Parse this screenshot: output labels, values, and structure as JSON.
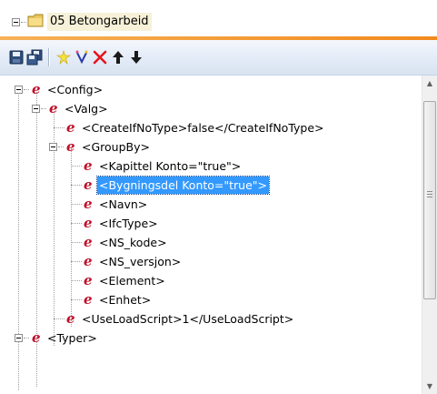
{
  "folder": {
    "title": "05 Betongarbeid"
  },
  "toolbar": {
    "buttons": [
      {
        "name": "save-icon",
        "icon": "floppy-disk"
      },
      {
        "name": "save-all-icon",
        "icon": "multiple-disks"
      },
      {
        "name": "new-element-icon",
        "icon": "star"
      },
      {
        "name": "new-attribute-icon",
        "icon": "sparkle-v"
      },
      {
        "name": "delete-icon",
        "icon": "red-x"
      },
      {
        "name": "move-up-icon",
        "icon": "arrow-up"
      },
      {
        "name": "move-down-icon",
        "icon": "arrow-down"
      }
    ],
    "accent": "#f28a1e",
    "delete_color": "#e8141d"
  },
  "tree": {
    "element_icon": "e",
    "icon_color": "#c0102a",
    "selected_color": "#3399ff",
    "nodes": [
      {
        "id": "config",
        "text": "<Config>"
      },
      {
        "id": "valg",
        "text": "<Valg>"
      },
      {
        "id": "createifnotype",
        "text": "<CreateIfNoType>false</CreateIfNoType>"
      },
      {
        "id": "groupby",
        "text": "<GroupBy>"
      },
      {
        "id": "kapittel",
        "text": "<Kapittel Konto=\"true\">"
      },
      {
        "id": "bygningsdel",
        "text": "<Bygningsdel Konto=\"true\">",
        "selected": true
      },
      {
        "id": "navn",
        "text": "<Navn>"
      },
      {
        "id": "ifctype",
        "text": "<IfcType>"
      },
      {
        "id": "ns-kode",
        "text": "<NS_kode>"
      },
      {
        "id": "ns-versjon",
        "text": "<NS_versjon>"
      },
      {
        "id": "element",
        "text": "<Element>"
      },
      {
        "id": "enhet",
        "text": "<Enhet>"
      },
      {
        "id": "useloadscript",
        "text": "<UseLoadScript>1</UseLoadScript>"
      },
      {
        "id": "typer",
        "text": "<Typer>"
      }
    ]
  }
}
